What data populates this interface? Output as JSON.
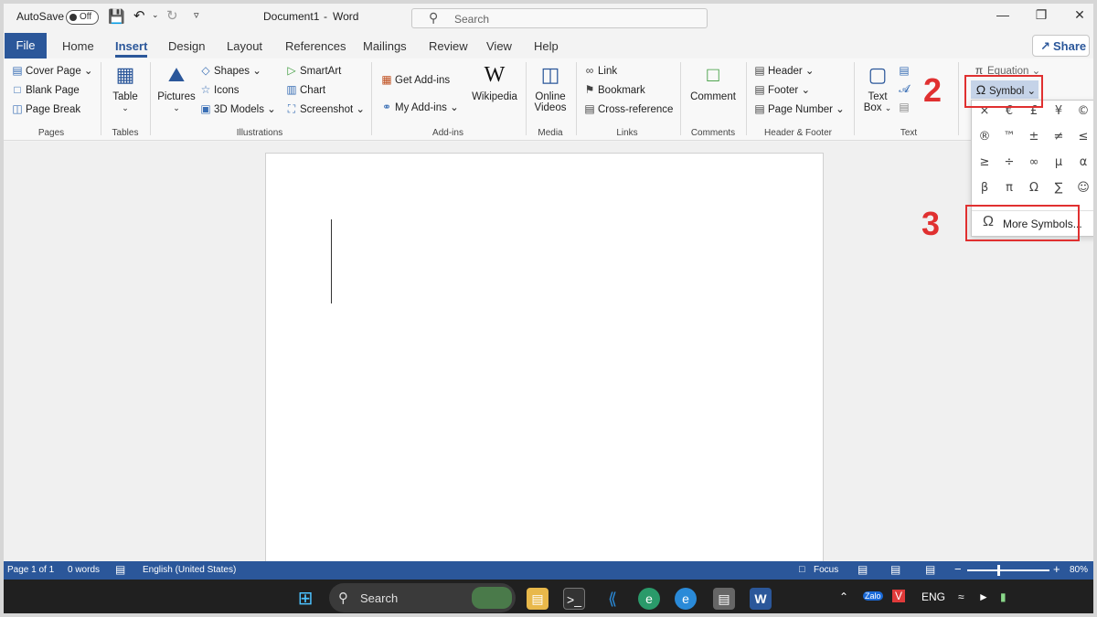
{
  "titlebar": {
    "autosave_label": "AutoSave",
    "autosave_state": "Off",
    "doc_title": "Document1",
    "separator": "-",
    "app_name": "Word",
    "search_placeholder": "Search"
  },
  "tabs": [
    "File",
    "Home",
    "Insert",
    "Design",
    "Layout",
    "References",
    "Mailings",
    "Review",
    "View",
    "Help"
  ],
  "active_tab": "Insert",
  "share_label": "Share",
  "ribbon": {
    "pages": {
      "items": [
        "Cover Page",
        "Blank Page",
        "Page Break"
      ],
      "label": "Pages"
    },
    "tables": {
      "button": "Table",
      "label": "Tables"
    },
    "illustrations": {
      "pictures": "Pictures",
      "items": [
        "Shapes",
        "Icons",
        "3D Models",
        "SmartArt",
        "Chart",
        "Screenshot"
      ],
      "label": "Illustrations"
    },
    "addins": {
      "get": "Get Add-ins",
      "my": "My Add-ins",
      "wikipedia": "Wikipedia",
      "label": "Add-ins"
    },
    "media": {
      "line1": "Online",
      "line2": "Videos",
      "label": "Media"
    },
    "links": {
      "items": [
        "Link",
        "Bookmark",
        "Cross-reference"
      ],
      "label": "Links"
    },
    "comments": {
      "button": "Comment",
      "label": "Comments"
    },
    "header_footer": {
      "items": [
        "Header",
        "Footer",
        "Page Number"
      ],
      "label": "Header & Footer"
    },
    "text": {
      "line1": "Text",
      "line2": "Box",
      "label": "Text"
    },
    "symbols": {
      "equation": "Equation",
      "symbol": "Symbol"
    }
  },
  "symbol_dropdown": {
    "symbols": [
      "×",
      "€",
      "£",
      "¥",
      "©",
      "®",
      "™",
      "±",
      "≠",
      "≤",
      "≥",
      "÷",
      "∞",
      "µ",
      "α",
      "β",
      "π",
      "Ω",
      "∑",
      "☺"
    ],
    "more_symbols": "More Symbols..."
  },
  "annotations": {
    "step2": "2",
    "step3": "3"
  },
  "statusbar": {
    "page": "Page 1 of 1",
    "words": "0 words",
    "language": "English (United States)",
    "focus": "Focus",
    "zoom": "80%"
  },
  "taskbar": {
    "search": "Search",
    "lang": "ENG"
  },
  "colors": {
    "accent": "#2b579a",
    "annotation": "#e03030"
  }
}
